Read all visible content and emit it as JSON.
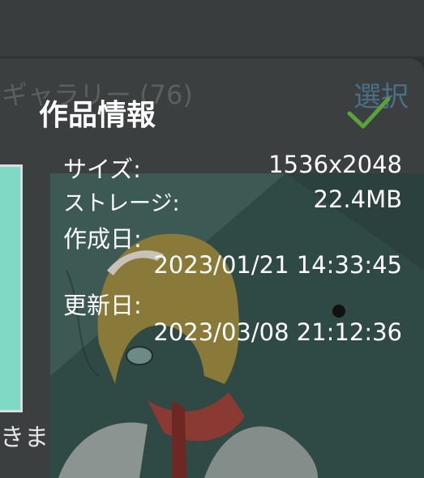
{
  "background": {
    "gallery_title": "ギャラリー (76)",
    "select_label": "選択",
    "hint_text": "きます"
  },
  "dialog": {
    "title": "作品情報",
    "confirm_icon": "check-icon",
    "rows": {
      "size_label": "サイズ:",
      "size_value": "1536x2048",
      "storage_label": "ストレージ:",
      "storage_value": "22.4MB",
      "created_label": "作成日:",
      "created_value": "2023/01/21 14:33:45",
      "updated_label": "更新日:",
      "updated_value": "2023/03/08 21:12:36"
    }
  },
  "colors": {
    "accent_check": "#5aa23a",
    "background": "#2f3232",
    "art_teal": "#2f4f49"
  }
}
